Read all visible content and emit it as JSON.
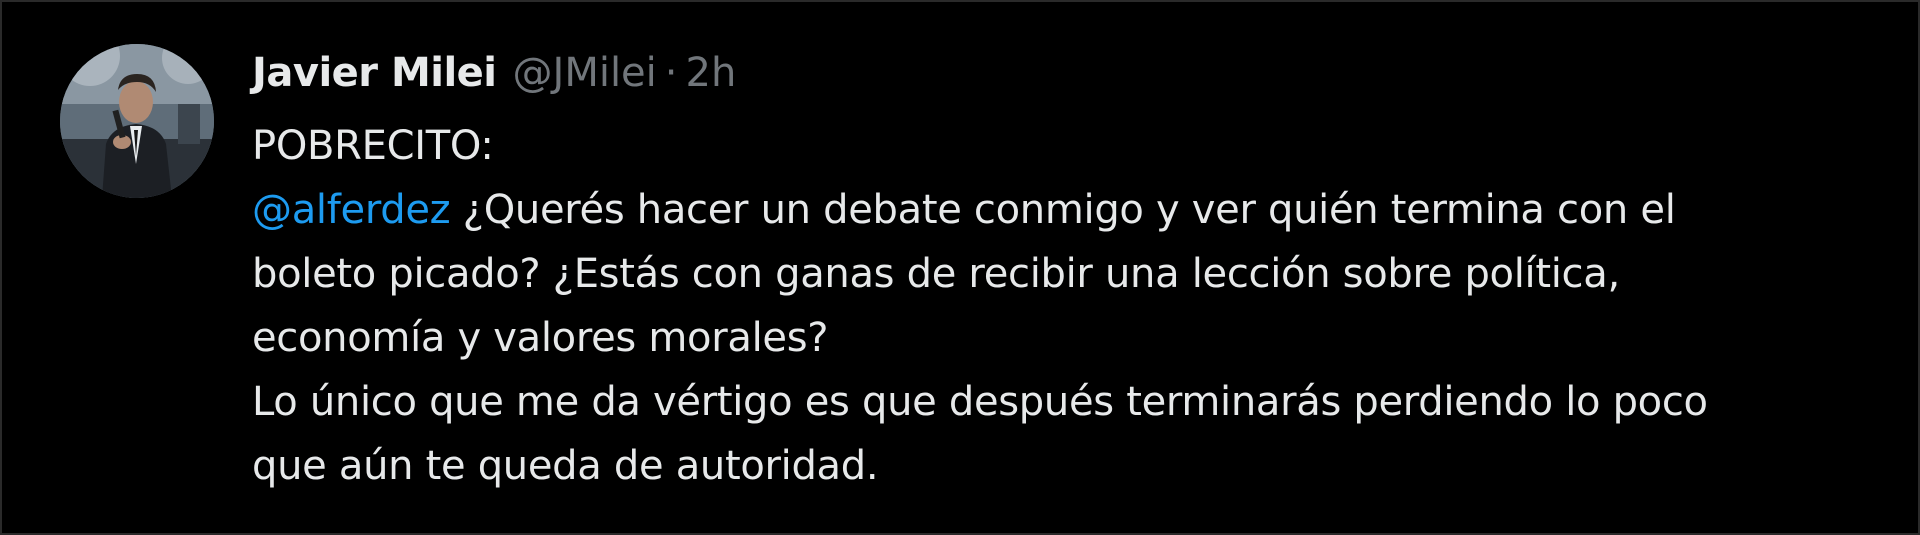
{
  "tweet": {
    "author": {
      "display_name": "Javier Milei",
      "handle": "@JMilei",
      "separator": "·",
      "time": "2h"
    },
    "text": {
      "line1": "POBRECITO:",
      "mention": "@alferdez",
      "line2_rest": " ¿Querés hacer un debate conmigo y ver quién termina con el",
      "line3": "boleto picado? ¿Estás con ganas de recibir una lección sobre política,",
      "line4": "economía y valores morales?",
      "line5": "Lo único que me da vértigo es que después terminarás perdiendo lo poco",
      "line6": "que aún te queda de autoridad."
    },
    "colors": {
      "background": "#000000",
      "text": "#e7e9ea",
      "muted": "#71767b",
      "link": "#1d9bf0"
    }
  }
}
